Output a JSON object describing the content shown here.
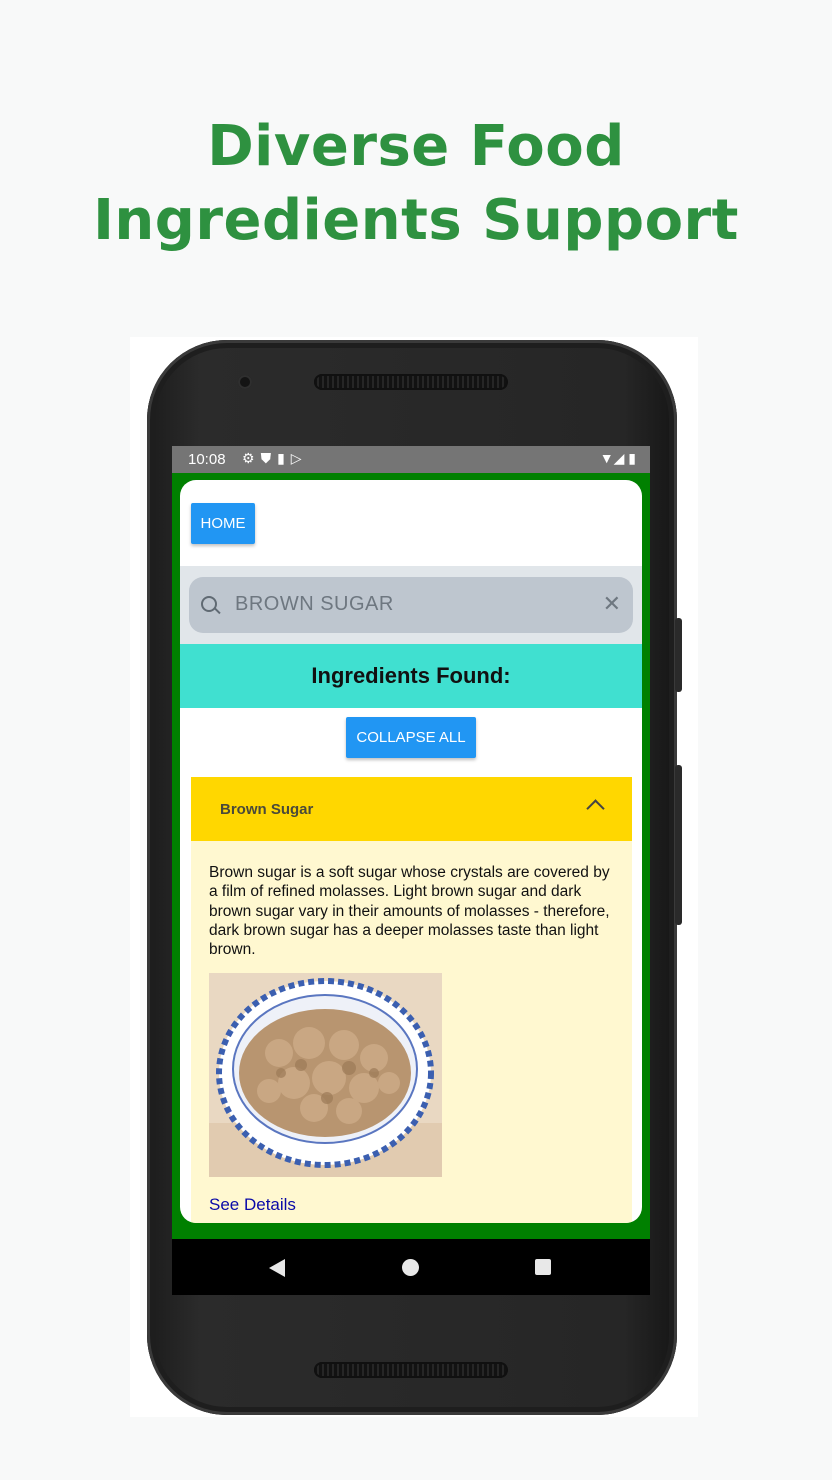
{
  "headline": {
    "line1": "Diverse Food",
    "line2": "Ingredients Support"
  },
  "status_bar": {
    "time": "10:08",
    "icons": [
      "gear-icon",
      "shield-icon",
      "sd-card-icon",
      "play-store-icon"
    ],
    "right_icons": [
      "wifi-icon",
      "signal-icon",
      "battery-icon"
    ]
  },
  "app": {
    "home_label": "HOME",
    "search": {
      "value": "BROWN SUGAR",
      "clear_glyph": "✕"
    },
    "found_title": "Ingredients Found:",
    "collapse_label": "COLLAPSE ALL",
    "accordion": {
      "title": "Brown Sugar",
      "expanded": true,
      "description": "Brown sugar is a soft sugar whose crystals are covered by a film of refined molasses. Light brown sugar and dark brown sugar vary in their amounts of molasses - therefore, dark brown sugar has a deeper molasses taste than light brown.",
      "link": "See Details"
    }
  },
  "colors": {
    "headline": "#2e9140",
    "app_background": "#008000",
    "button": "#2196f3",
    "found_bar": "#40e0d0",
    "accordion_header": "#ffd700",
    "accordion_body": "#fff8d0",
    "link": "#0a0aa8"
  }
}
